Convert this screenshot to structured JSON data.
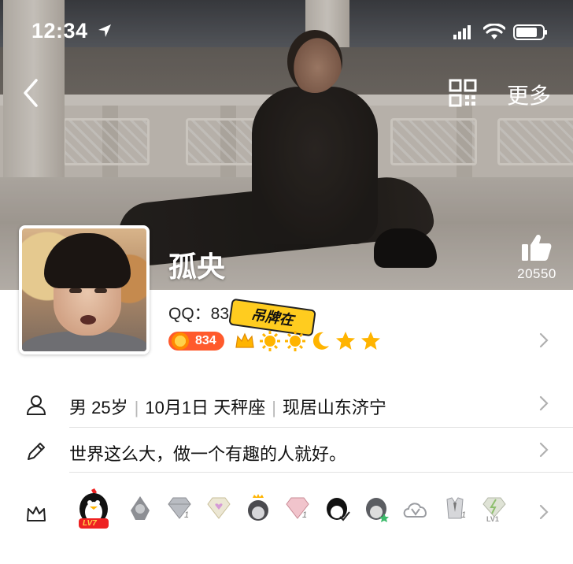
{
  "status_bar": {
    "time": "12:34"
  },
  "nav": {
    "more_label": "更多"
  },
  "profile": {
    "nickname": "孤央",
    "likes": "20550",
    "qq_label": "QQ：",
    "qq_number": "83 993",
    "id_badge": "ID",
    "sticker_text": "吊牌在",
    "level_value": "834"
  },
  "info": {
    "gender": "男",
    "age": "25岁",
    "birthday": "10月1日",
    "zodiac": "天秤座",
    "location": "现居山东济宁",
    "signature": "世界这么大，做一个有趣的人就好。"
  },
  "badges": {
    "main_level": "LV7",
    "count_marks": [
      "1",
      "1",
      "1"
    ],
    "last_level": "LV1"
  },
  "colors": {
    "accent_orange": "#ff5a2c",
    "star_gold": "#ffb400",
    "sticker_yellow": "#ffcc1f"
  }
}
